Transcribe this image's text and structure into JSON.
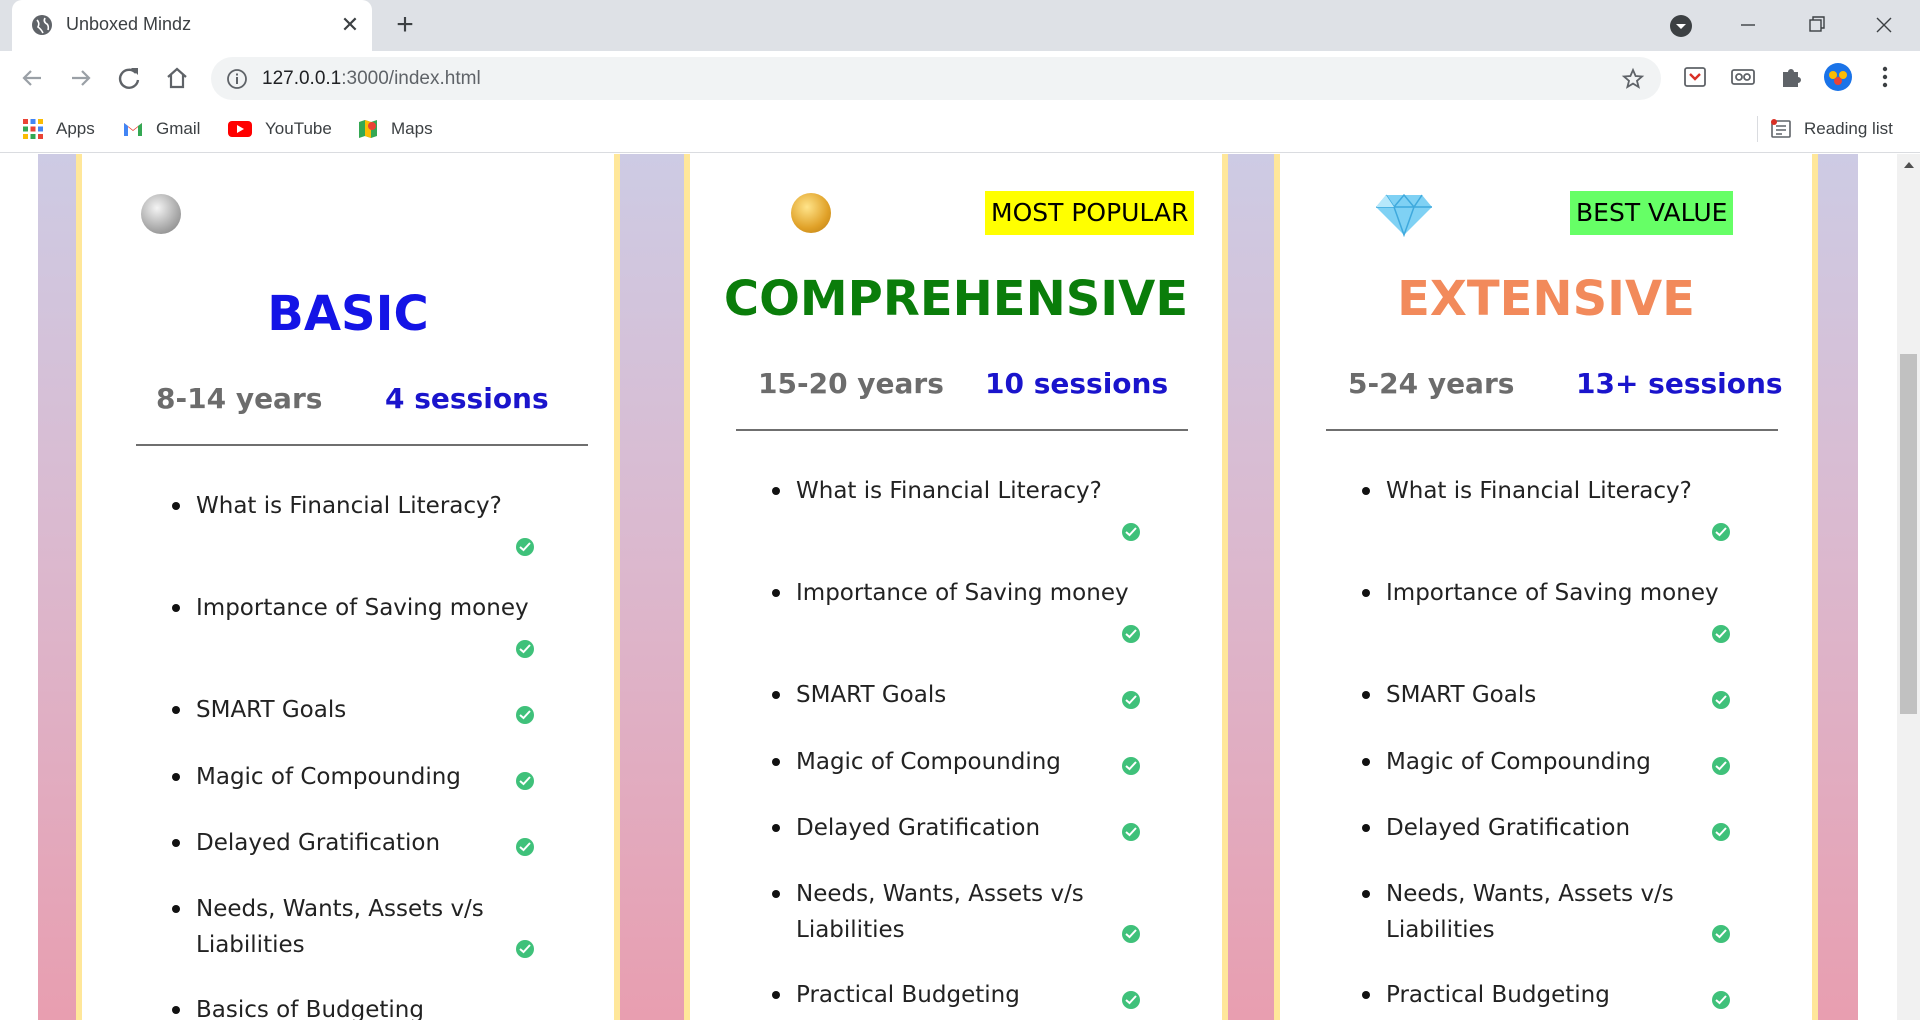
{
  "browser": {
    "tab_title": "Unboxed Mindz",
    "url_host": "127.0.0.1",
    "url_path": ":3000/index.html",
    "bookmarks": [
      "Apps",
      "Gmail",
      "YouTube",
      "Maps"
    ],
    "reading_list": "Reading list"
  },
  "plans": [
    {
      "title": "BASIC",
      "title_color": "#1414e6",
      "badge": "",
      "age": "8-14 years",
      "sessions": "4 sessions",
      "coin": "silver-coin-icon",
      "features": [
        "What is Financial Literacy?",
        "Importance of Saving money",
        "SMART Goals",
        "Magic of Compounding",
        "Delayed Gratification",
        "Needs, Wants, Assets v/s",
        "Liabilities",
        "Basics of Budgeting"
      ]
    },
    {
      "title": "COMPREHENSIVE",
      "title_color": "#0a7d0a",
      "badge": "MOST POPULAR",
      "badge_color": "#ffff00",
      "age": "15-20 years",
      "sessions": "10 sessions",
      "coin": "gold-coin-icon",
      "features": [
        "What is Financial Literacy?",
        "Importance of Saving money",
        "SMART Goals",
        "Magic of Compounding",
        "Delayed Gratification",
        "Needs, Wants, Assets v/s",
        "Liabilities",
        "Practical Budgeting"
      ]
    },
    {
      "title": "EXTENSIVE",
      "title_color": "#f28a5b",
      "badge": "BEST VALUE",
      "badge_color": "#66ff66",
      "age": "5-24 years",
      "sessions": "13+ sessions",
      "coin": "diamond-icon",
      "features": [
        "What is Financial Literacy?",
        "Importance of Saving money",
        "SMART Goals",
        "Magic of Compounding",
        "Delayed Gratification",
        "Needs, Wants, Assets v/s",
        "Liabilities",
        "Practical Budgeting"
      ]
    }
  ]
}
